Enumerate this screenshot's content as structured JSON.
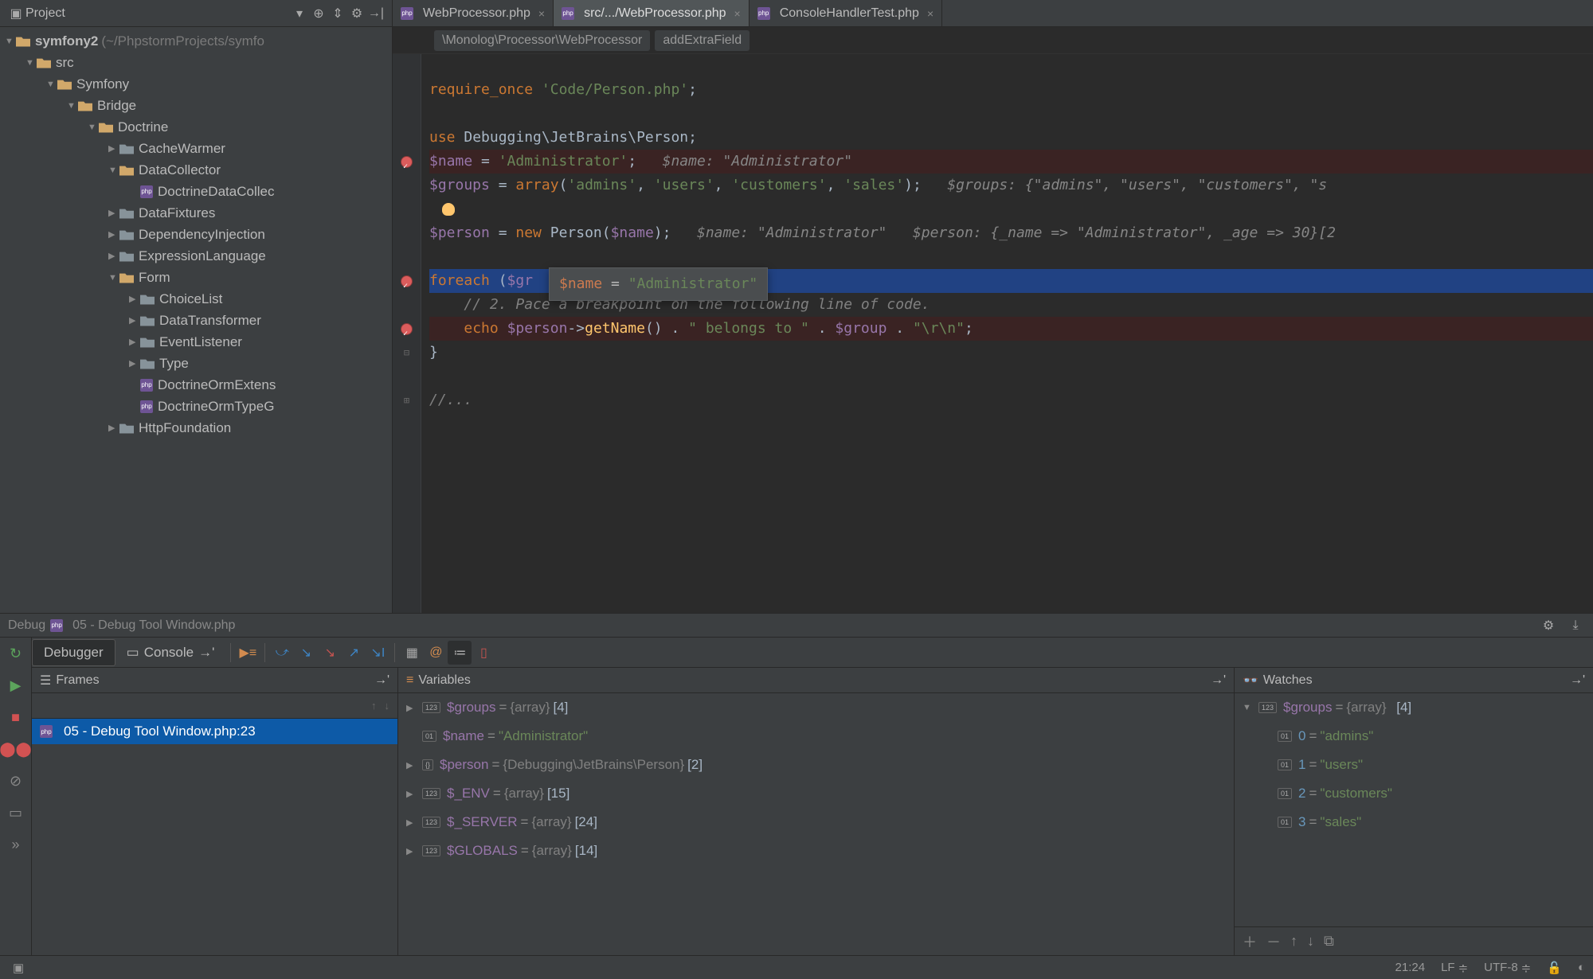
{
  "project": {
    "label": "Project",
    "root": {
      "name": "symfony2",
      "path": "(~/PhpstormProjects/symfo"
    },
    "tree": [
      {
        "indent": 1,
        "arrow": "▼",
        "icon": "folder-open",
        "label": "src"
      },
      {
        "indent": 2,
        "arrow": "▼",
        "icon": "folder-open",
        "label": "Symfony"
      },
      {
        "indent": 3,
        "arrow": "▼",
        "icon": "folder-open",
        "label": "Bridge"
      },
      {
        "indent": 4,
        "arrow": "▼",
        "icon": "folder-open",
        "label": "Doctrine"
      },
      {
        "indent": 5,
        "arrow": "▶",
        "icon": "folder-closed",
        "label": "CacheWarmer"
      },
      {
        "indent": 5,
        "arrow": "▼",
        "icon": "folder-open",
        "label": "DataCollector"
      },
      {
        "indent": 6,
        "arrow": "",
        "icon": "php",
        "label": "DoctrineDataCollec"
      },
      {
        "indent": 5,
        "arrow": "▶",
        "icon": "folder-closed",
        "label": "DataFixtures"
      },
      {
        "indent": 5,
        "arrow": "▶",
        "icon": "folder-closed",
        "label": "DependencyInjection"
      },
      {
        "indent": 5,
        "arrow": "▶",
        "icon": "folder-closed",
        "label": "ExpressionLanguage"
      },
      {
        "indent": 5,
        "arrow": "▼",
        "icon": "folder-open",
        "label": "Form"
      },
      {
        "indent": 6,
        "arrow": "▶",
        "icon": "folder-closed",
        "label": "ChoiceList"
      },
      {
        "indent": 6,
        "arrow": "▶",
        "icon": "folder-closed",
        "label": "DataTransformer"
      },
      {
        "indent": 6,
        "arrow": "▶",
        "icon": "folder-closed",
        "label": "EventListener"
      },
      {
        "indent": 6,
        "arrow": "▶",
        "icon": "folder-closed",
        "label": "Type"
      },
      {
        "indent": 6,
        "arrow": "",
        "icon": "php",
        "label": "DoctrineOrmExtens"
      },
      {
        "indent": 6,
        "arrow": "",
        "icon": "php",
        "label": "DoctrineOrmTypeG"
      },
      {
        "indent": 5,
        "arrow": "▶",
        "icon": "folder-closed",
        "label": "HttpFoundation"
      }
    ]
  },
  "editor": {
    "tabs": [
      {
        "label": "WebProcessor.php",
        "active": false
      },
      {
        "label": "src/.../WebProcessor.php",
        "active": true
      },
      {
        "label": "ConsoleHandlerTest.php",
        "active": false
      }
    ],
    "breadcrumb": [
      "\\Monolog\\Processor\\WebProcessor",
      "addExtraField"
    ],
    "code": {
      "l1a": "require_once",
      "l1b": "'Code/Person.php'",
      "l1c": ";",
      "l3a": "use",
      "l3b": " Debugging\\JetBrains\\Person;",
      "l5a": "$name",
      "l5b": " = ",
      "l5c": "'Administrator'",
      "l5d": ";",
      "l5hint": "$name: \"Administrator\"",
      "l6a": "$groups",
      "l6b": " = ",
      "l6c": "array",
      "l6d": "(",
      "l6e": "'admins'",
      "l6f": ", ",
      "l6g": "'users'",
      "l6h": ", ",
      "l6i": "'customers'",
      "l6j": ", ",
      "l6k": "'sales'",
      "l6l": ");",
      "l6hint": "$groups: {\"admins\", \"users\", \"customers\", \"s",
      "l8a": "$person",
      "l8b": " = ",
      "l8c": "new",
      "l8d": " Person(",
      "l8e": "$name",
      "l8f": ");",
      "l8hint1": "$name: \"Administrator\"",
      "l8hint2": "$person: {_name => \"Administrator\", _age => 30}[2",
      "l10a": "foreach",
      "l10b": " (",
      "l10c": "$gr",
      "l11a": "// 2. P",
      "l11b": "ace a breakpoint on the ",
      "l11c": "following line of code.",
      "l12a": "echo",
      "l12b": " ",
      "l12c": "$person",
      "l12d": "->",
      "l12e": "getName",
      "l12f": "() . ",
      "l12g": "\" belongs to \"",
      "l12h": " . ",
      "l12i": "$group",
      "l12j": " . ",
      "l12k": "\"\\r\\n\"",
      "l12l": ";",
      "l13": "}",
      "l15": "//..."
    },
    "tooltip": {
      "var": "$name",
      "eq": " = ",
      "val": "\"Administrator\""
    }
  },
  "debug": {
    "title": "Debug",
    "title_file": "05 - Debug Tool Window.php",
    "tabs": {
      "debugger": "Debugger",
      "console": "Console"
    },
    "frames": {
      "title": "Frames",
      "item": "05 - Debug Tool Window.php:23"
    },
    "variables": {
      "title": "Variables",
      "items": [
        {
          "arrow": "▶",
          "badge": "123",
          "name": "$groups",
          "type": "{array}",
          "extra": "[4]"
        },
        {
          "arrow": "",
          "badge": "01",
          "name": "$name",
          "val": "\"Administrator\""
        },
        {
          "arrow": "▶",
          "badge": "{}",
          "name": "$person",
          "type": "{Debugging\\JetBrains\\Person}",
          "extra": "[2]"
        },
        {
          "arrow": "▶",
          "badge": "123",
          "name": "$_ENV",
          "type": "{array}",
          "extra": "[15]"
        },
        {
          "arrow": "▶",
          "badge": "123",
          "name": "$_SERVER",
          "type": "{array}",
          "extra": "[24]"
        },
        {
          "arrow": "▶",
          "badge": "123",
          "name": "$GLOBALS",
          "type": "{array}",
          "extra": "[14]"
        }
      ]
    },
    "watches": {
      "title": "Watches",
      "root": {
        "name": "$groups",
        "type": "{array}",
        "extra": "[4]"
      },
      "items": [
        {
          "idx": "0",
          "val": "\"admins\""
        },
        {
          "idx": "1",
          "val": "\"users\""
        },
        {
          "idx": "2",
          "val": "\"customers\""
        },
        {
          "idx": "3",
          "val": "\"sales\""
        }
      ]
    }
  },
  "status": {
    "pos": "21:24",
    "le": "LF",
    "enc": "UTF-8"
  }
}
